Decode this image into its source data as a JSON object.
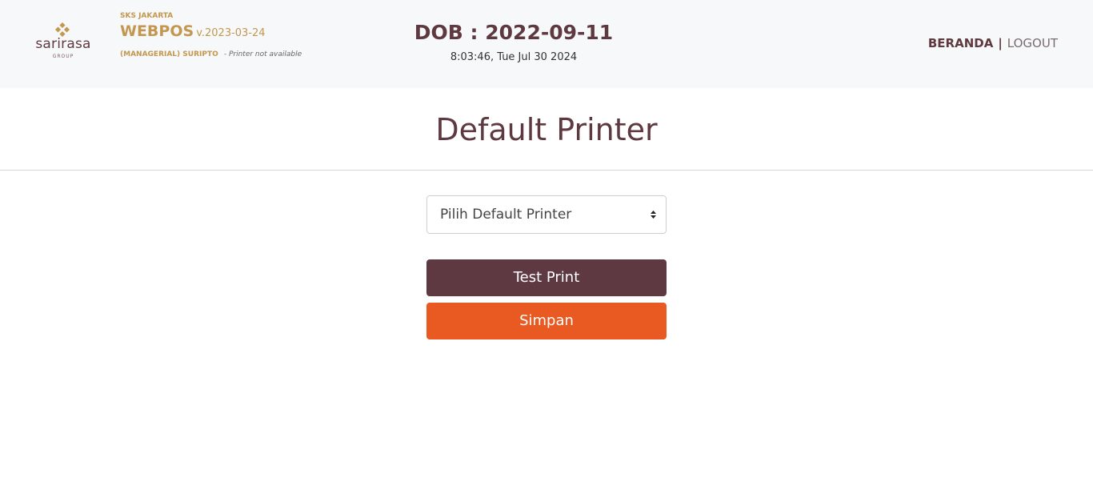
{
  "header": {
    "logo": {
      "word": "sarirasa",
      "sub": "GROUP"
    },
    "store_name": "SKS JAKARTA",
    "app_name": "WEBPOS",
    "app_version": "v.2023-03-24",
    "user_name": "(MANAGERIAL) SURIPTO",
    "printer_status": "- Printer not available",
    "dob": "DOB : 2022-09-11",
    "clock": "8:03:46, Tue Jul 30 2024",
    "nav": {
      "home": "BERANDA",
      "separator": "|",
      "logout": "LOGOUT"
    }
  },
  "main": {
    "title": "Default Printer",
    "printer_select": {
      "value": "Pilih Default Printer"
    },
    "test_print_label": "Test Print",
    "save_label": "Simpan"
  },
  "colors": {
    "brand_maroon": "#5e3a40",
    "brand_gold": "#c3974f",
    "accent_orange": "#e85a22",
    "header_bg": "#f7f8fa"
  },
  "icons": {
    "logo_mark": "sarirasa-diamond-icon",
    "select_arrows": "select-updown-icon"
  }
}
